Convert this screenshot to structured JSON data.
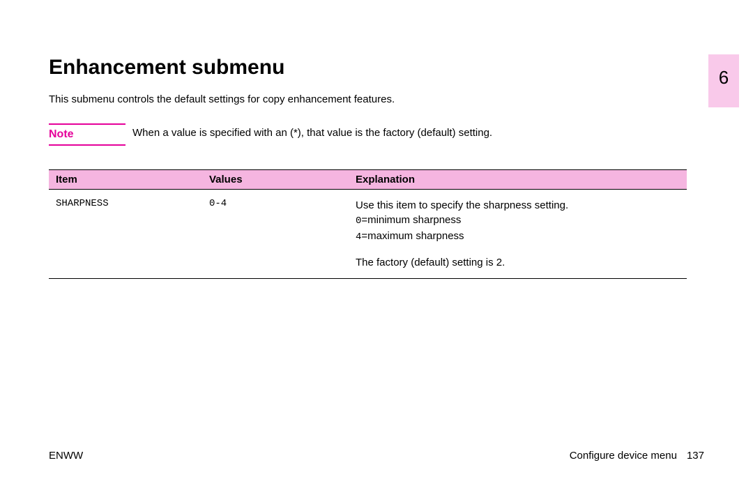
{
  "heading": "Enhancement submenu",
  "intro": "This submenu controls the default settings for copy enhancement features.",
  "note": {
    "label": "Note",
    "text": "When a value is specified with an (*), that value is the factory (default) setting."
  },
  "chapter": "6",
  "table": {
    "headers": {
      "item": "Item",
      "values": "Values",
      "explanation": "Explanation"
    },
    "row": {
      "item": "SHARPNESS",
      "values": "0-4",
      "exp_line1": "Use this item to specify the sharpness setting.",
      "exp_line2_code": "0",
      "exp_line2_rest": "=minimum sharpness",
      "exp_line3_code": "4",
      "exp_line3_rest": "=maximum sharpness",
      "exp_line4": "The factory (default) setting is 2."
    }
  },
  "footer": {
    "left": "ENWW",
    "right_text": "Configure device menu",
    "page_num": "137"
  }
}
